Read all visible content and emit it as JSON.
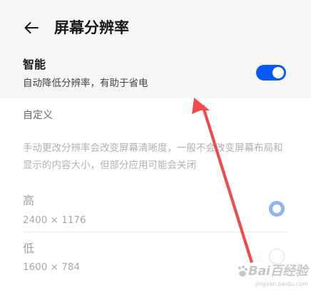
{
  "header": {
    "title": "屏幕分辨率",
    "back_icon": "arrow-left-icon"
  },
  "smart": {
    "title": "智能",
    "description": "自动降低分辨率，有助于省电",
    "toggle_on": true,
    "accent_color": "#0a59f7"
  },
  "custom": {
    "section_label": "自定义",
    "description": "手动更改分辨率会改变屏幕清晰度，一般不会改变屏幕布局和显示的内容大小，但部分应用可能会关闭",
    "options": [
      {
        "label": "高",
        "value": "2400 × 1176",
        "selected": true
      },
      {
        "label": "低",
        "value": "1600 × 784",
        "selected": false
      }
    ]
  },
  "overlay": {
    "annotation_color": "#f04a4a"
  },
  "watermark": {
    "text": "Bai百经验",
    "sub": "jingyan.baidu.com"
  }
}
